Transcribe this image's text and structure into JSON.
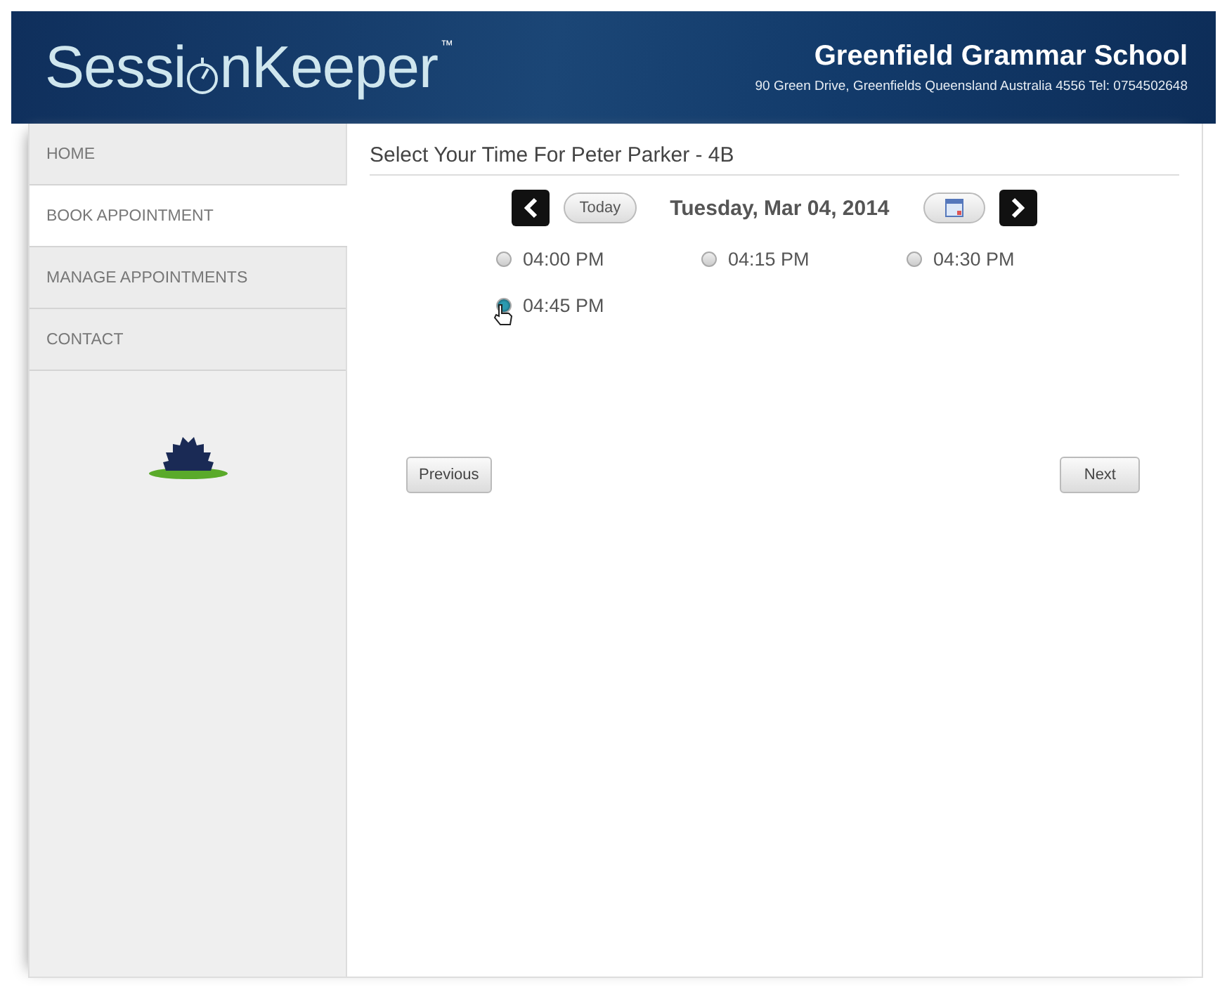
{
  "header": {
    "logo_start": "Sessi",
    "logo_end": "nKeeper",
    "trademark": "™",
    "school": "Greenfield Grammar School",
    "address": "90 Green Drive, Greenfields Queensland Australia 4556 Tel: 0754502648"
  },
  "sidebar": {
    "items": [
      {
        "label": "HOME",
        "selected": false
      },
      {
        "label": "BOOK APPOINTMENT",
        "selected": true
      },
      {
        "label": "MANAGE APPOINTMENTS",
        "selected": false
      },
      {
        "label": "CONTACT",
        "selected": false
      }
    ]
  },
  "content": {
    "title": "Select Your Time For Peter Parker - 4B",
    "today": "Today",
    "date": "Tuesday, Mar 04, 2014",
    "slots": [
      {
        "label": "04:00 PM",
        "selected": false
      },
      {
        "label": "04:15 PM",
        "selected": false
      },
      {
        "label": "04:30 PM",
        "selected": false
      },
      {
        "label": "04:45 PM",
        "selected": true
      }
    ],
    "previous": "Previous",
    "next": "Next"
  }
}
